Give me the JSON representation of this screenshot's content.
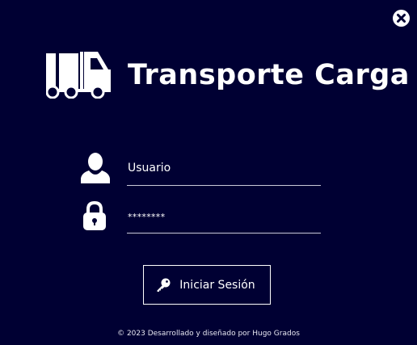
{
  "window": {
    "close_icon": "close-icon"
  },
  "brand": {
    "logo_icon": "truck-icon",
    "title": "Transporte Carga"
  },
  "login": {
    "username_placeholder": "Usuario",
    "user_icon": "user-icon",
    "password_value": "********",
    "lock_icon": "lock-icon",
    "submit_label": "Iniciar Sesión",
    "submit_icon": "key-icon"
  },
  "footer": {
    "text": "© 2023 Desarrollado y diseñado por Hugo Grados"
  },
  "colors": {
    "background": "#000033",
    "foreground": "#ffffff"
  }
}
